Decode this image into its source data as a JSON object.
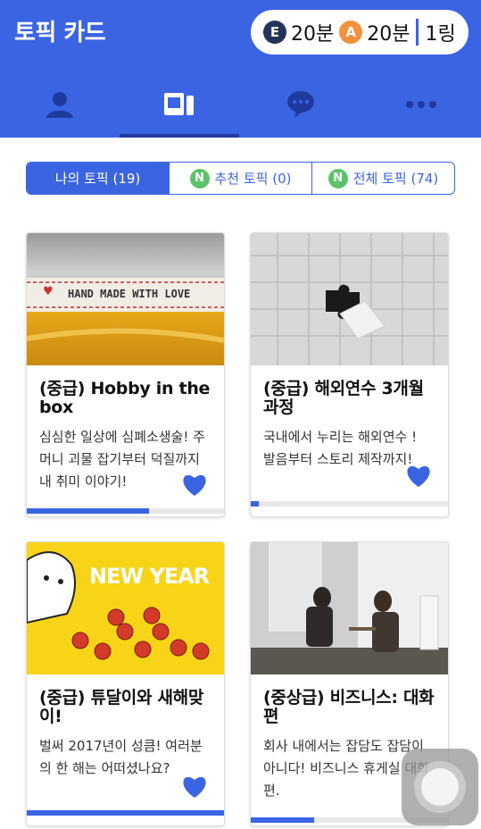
{
  "header": {
    "title": "토픽 카드",
    "status": {
      "e_badge": "E",
      "e_time": "20분",
      "a_badge": "A",
      "a_time": "20분",
      "rank": "1링"
    },
    "tabs": [
      {
        "icon": "person-icon",
        "active": false
      },
      {
        "icon": "cards-icon",
        "active": true
      },
      {
        "icon": "chat-icon",
        "active": false
      },
      {
        "icon": "more-icon",
        "active": false
      }
    ]
  },
  "filter": {
    "options": [
      {
        "label": "나의 토픽 (19)",
        "active": true,
        "badge": ""
      },
      {
        "label": "추천 토픽 (0)",
        "active": false,
        "badge": "N"
      },
      {
        "label": "전체 토픽 (74)",
        "active": false,
        "badge": "N"
      }
    ]
  },
  "cards": [
    {
      "title": "(중급) Hobby in the box",
      "desc": "심심한 일상에 심폐소생술! 주머니 괴물 잡기부터 덕질까지 내 취미 이야기!",
      "image_text": "HAND MADE WITH LOVE",
      "progress": 0.62
    },
    {
      "title": "(중급) 해외연수 3개월 과정",
      "desc": "국내에서 누리는 해외연수 ! 발음부터 스토리 제작까지!",
      "image_text": "",
      "progress": 0.04
    },
    {
      "title": "(중급) 튜달이와 새해맞이!",
      "desc": "벌써 2017년이 성큼! 여러분의 한 해는 어떠셨나요?",
      "image_text": "NEW YEAR",
      "progress": 1.0
    },
    {
      "title": "(중상급) 비즈니스: 대화편",
      "desc": "회사 내에서는 잡담도 잡담이 아니다! 비즈니스 휴게실 대화편.",
      "image_text": "",
      "progress": 0.32
    }
  ],
  "colors": {
    "primary": "#3b64e2",
    "badge_e": "#22345a",
    "badge_a": "#f1913c",
    "badge_n": "#5bc46a"
  }
}
